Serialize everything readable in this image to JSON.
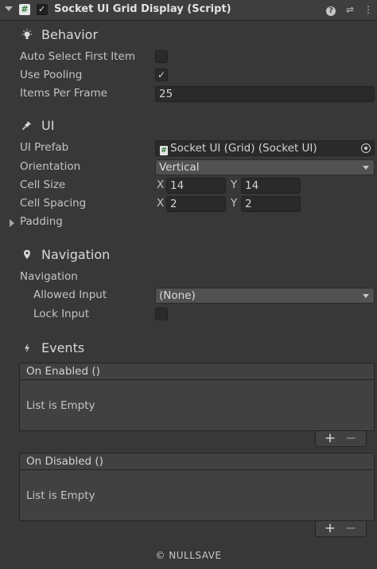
{
  "header": {
    "title": "Socket UI Grid Display (Script)",
    "enabled_check": "✓",
    "script_glyph": "#",
    "help_glyph": "?",
    "presets_glyph": "⇌",
    "menu_glyph": "⋮"
  },
  "behavior": {
    "title": "Behavior",
    "icon": "lightbulb-icon",
    "auto_select_label": "Auto Select First Item",
    "auto_select_checked": false,
    "use_pooling_label": "Use Pooling",
    "use_pooling_checked": true,
    "use_pooling_mark": "✓",
    "items_per_frame_label": "Items Per Frame",
    "items_per_frame_value": "25"
  },
  "ui": {
    "title": "UI",
    "icon": "pin-icon",
    "prefab_label": "UI Prefab",
    "prefab_value": "Socket UI (Grid) (Socket UI)",
    "orientation_label": "Orientation",
    "orientation_value": "Vertical",
    "cell_size_label": "Cell Size",
    "cell_size_x_label": "X",
    "cell_size_x": "14",
    "cell_size_y_label": "Y",
    "cell_size_y": "14",
    "cell_spacing_label": "Cell Spacing",
    "cell_spacing_x_label": "X",
    "cell_spacing_x": "2",
    "cell_spacing_y_label": "Y",
    "cell_spacing_y": "2",
    "padding_label": "Padding"
  },
  "navigation": {
    "title": "Navigation",
    "icon": "location-pin-icon",
    "group_label": "Navigation",
    "allowed_input_label": "Allowed Input",
    "allowed_input_value": "(None)",
    "lock_input_label": "Lock Input",
    "lock_input_checked": false
  },
  "events": {
    "title": "Events",
    "icon": "lightning-icon",
    "on_enabled": {
      "label": "On Enabled ()",
      "empty_text": "List is Empty",
      "add_glyph": "+",
      "remove_glyph": "−"
    },
    "on_disabled": {
      "label": "On Disabled ()",
      "empty_text": "List is Empty",
      "add_glyph": "+",
      "remove_glyph": "−"
    }
  },
  "footer": {
    "text": "© NULLSAVE"
  }
}
